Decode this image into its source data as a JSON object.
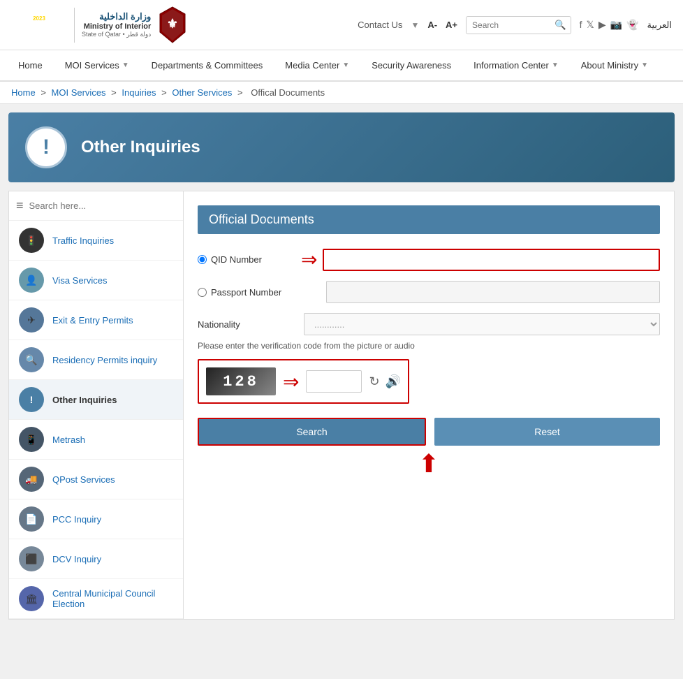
{
  "topbar": {
    "contact_us": "Contact Us",
    "font_a_minus": "A-",
    "font_a_plus": "A+",
    "search_placeholder": "Search",
    "arabic_link": "العربية"
  },
  "nav": {
    "items": [
      {
        "label": "Home",
        "has_arrow": false
      },
      {
        "label": "MOI Services",
        "has_arrow": true
      },
      {
        "label": "Departments & Committees",
        "has_arrow": false
      },
      {
        "label": "Media Center",
        "has_arrow": true
      },
      {
        "label": "Security Awareness",
        "has_arrow": false
      },
      {
        "label": "Information Center",
        "has_arrow": true
      },
      {
        "label": "About Ministry",
        "has_arrow": true
      }
    ]
  },
  "breadcrumb": {
    "items": [
      "Home",
      "MOI Services",
      "Inquiries",
      "Other Services",
      "Offical Documents"
    ],
    "separator": ">"
  },
  "banner": {
    "title": "Other Inquiries",
    "icon": "!"
  },
  "sidebar": {
    "search_placeholder": "Search here...",
    "items": [
      {
        "label": "Traffic Inquiries",
        "icon": "🚦"
      },
      {
        "label": "Visa Services",
        "icon": "👤"
      },
      {
        "label": "Exit & Entry Permits",
        "icon": "✈"
      },
      {
        "label": "Residency Permits inquiry",
        "icon": "🔍"
      },
      {
        "label": "Other Inquiries",
        "icon": "!",
        "active": true
      },
      {
        "label": "Metrash",
        "icon": "📱"
      },
      {
        "label": "QPost Services",
        "icon": "🚚"
      },
      {
        "label": "PCC Inquiry",
        "icon": "📄"
      },
      {
        "label": "DCV Inquiry",
        "icon": "⬛"
      },
      {
        "label": "Central Municipal Council Election",
        "icon": "🏛"
      }
    ]
  },
  "form": {
    "title": "Official Documents",
    "qid_label": "QID Number",
    "passport_label": "Passport Number",
    "nationality_label": "Nationality",
    "nationality_placeholder": "............",
    "verification_note": "Please enter the verification code from the picture or audio",
    "captcha_text": "128",
    "search_button": "Search",
    "reset_button": "Reset"
  }
}
